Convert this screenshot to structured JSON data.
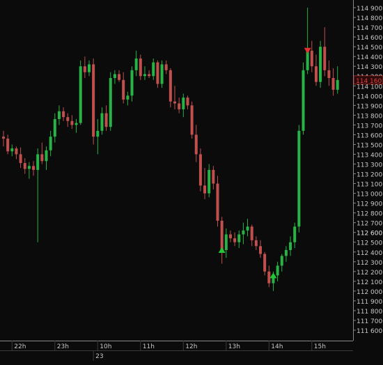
{
  "colors": {
    "background": "#0b0b0b",
    "up_candle": "#27b345",
    "down_candle": "#c0504d",
    "axis_text": "#c8c8c8",
    "axis_line": "#8a8a8a",
    "last_price_box": "#2a0a0a",
    "last_price_text": "#e04040",
    "buy_marker": "#22c832",
    "sell_marker": "#e83030"
  },
  "chart_data": {
    "type": "candlestick",
    "y_unit": "price",
    "ylim": [
      111550,
      114950
    ],
    "y_ticks": [
      "111 600",
      "111 700",
      "111 800",
      "111 900",
      "112 000",
      "112 100",
      "112 200",
      "112 300",
      "112 400",
      "112 500",
      "112 600",
      "112 700",
      "112 800",
      "112 900",
      "113 000",
      "113 100",
      "113 200",
      "113 300",
      "113 400",
      "113 500",
      "113 600",
      "113 700",
      "113 800",
      "113 900",
      "114 000",
      "114 100",
      "114 200",
      "114 300",
      "114 400",
      "114 500",
      "114 600",
      "114 700",
      "114 800",
      "114 900"
    ],
    "y_tick_values": [
      111600,
      111700,
      111800,
      111900,
      112000,
      112100,
      112200,
      112300,
      112400,
      112500,
      112600,
      112700,
      112800,
      112900,
      113000,
      113100,
      113200,
      113300,
      113400,
      113500,
      113600,
      113700,
      113800,
      113900,
      114000,
      114100,
      114200,
      114300,
      114400,
      114500,
      114600,
      114700,
      114800,
      114900
    ],
    "last_price": {
      "label": "114 160",
      "value": 114160
    },
    "right_edge_labels": [
      {
        "label": "112 600",
        "value": 112600
      }
    ],
    "x_time_labels": [
      {
        "label": "22h",
        "index": 2
      },
      {
        "label": "23h",
        "index": 12
      },
      {
        "label": "10h",
        "index": 22
      },
      {
        "label": "11h",
        "index": 32
      },
      {
        "label": "12h",
        "index": 42
      },
      {
        "label": "13h",
        "index": 52
      },
      {
        "label": "14h",
        "index": 62
      },
      {
        "label": "15h",
        "index": 72
      }
    ],
    "x_date_labels": [
      {
        "label": "23",
        "index": 21
      }
    ],
    "candles": [
      {
        "o": 113580,
        "h": 113640,
        "l": 113480,
        "c": 113560
      },
      {
        "o": 113560,
        "h": 113600,
        "l": 113400,
        "c": 113430
      },
      {
        "o": 113430,
        "h": 113500,
        "l": 113380,
        "c": 113460
      },
      {
        "o": 113460,
        "h": 113480,
        "l": 113350,
        "c": 113400
      },
      {
        "o": 113400,
        "h": 113470,
        "l": 113260,
        "c": 113310
      },
      {
        "o": 113310,
        "h": 113360,
        "l": 113200,
        "c": 113250
      },
      {
        "o": 113250,
        "h": 113320,
        "l": 113150,
        "c": 113280
      },
      {
        "o": 113280,
        "h": 113330,
        "l": 113180,
        "c": 113240
      },
      {
        "o": 113240,
        "h": 113460,
        "l": 112500,
        "c": 113400
      },
      {
        "o": 113400,
        "h": 113520,
        "l": 113300,
        "c": 113330
      },
      {
        "o": 113330,
        "h": 113480,
        "l": 113240,
        "c": 113440
      },
      {
        "o": 113440,
        "h": 113640,
        "l": 113380,
        "c": 113580
      },
      {
        "o": 113580,
        "h": 113820,
        "l": 113520,
        "c": 113760
      },
      {
        "o": 113760,
        "h": 113900,
        "l": 113700,
        "c": 113840
      },
      {
        "o": 113840,
        "h": 113880,
        "l": 113740,
        "c": 113780
      },
      {
        "o": 113780,
        "h": 113820,
        "l": 113680,
        "c": 113740
      },
      {
        "o": 113740,
        "h": 113800,
        "l": 113660,
        "c": 113700
      },
      {
        "o": 113700,
        "h": 113760,
        "l": 113620,
        "c": 113720
      },
      {
        "o": 113720,
        "h": 114360,
        "l": 113700,
        "c": 114300
      },
      {
        "o": 114300,
        "h": 114400,
        "l": 114180,
        "c": 114240
      },
      {
        "o": 114240,
        "h": 114360,
        "l": 114200,
        "c": 114320
      },
      {
        "o": 114320,
        "h": 114380,
        "l": 113500,
        "c": 113580
      },
      {
        "o": 113580,
        "h": 113760,
        "l": 113400,
        "c": 113640
      },
      {
        "o": 113640,
        "h": 113880,
        "l": 113600,
        "c": 113820
      },
      {
        "o": 113820,
        "h": 113900,
        "l": 113640,
        "c": 113680
      },
      {
        "o": 113680,
        "h": 114240,
        "l": 113640,
        "c": 114180
      },
      {
        "o": 114180,
        "h": 114260,
        "l": 114120,
        "c": 114220
      },
      {
        "o": 114220,
        "h": 114260,
        "l": 114140,
        "c": 114160
      },
      {
        "o": 114160,
        "h": 114240,
        "l": 113920,
        "c": 113960
      },
      {
        "o": 113960,
        "h": 114040,
        "l": 113900,
        "c": 114000
      },
      {
        "o": 114000,
        "h": 114300,
        "l": 113940,
        "c": 114260
      },
      {
        "o": 114260,
        "h": 114460,
        "l": 114200,
        "c": 114380
      },
      {
        "o": 114380,
        "h": 114420,
        "l": 114160,
        "c": 114200
      },
      {
        "o": 114200,
        "h": 114300,
        "l": 114160,
        "c": 114220
      },
      {
        "o": 114220,
        "h": 114260,
        "l": 114180,
        "c": 114200
      },
      {
        "o": 114200,
        "h": 114380,
        "l": 114160,
        "c": 114340
      },
      {
        "o": 114340,
        "h": 114360,
        "l": 114080,
        "c": 114120
      },
      {
        "o": 114120,
        "h": 114360,
        "l": 114080,
        "c": 114320
      },
      {
        "o": 114320,
        "h": 114360,
        "l": 114220,
        "c": 114260
      },
      {
        "o": 114260,
        "h": 114280,
        "l": 113880,
        "c": 113940
      },
      {
        "o": 113940,
        "h": 114100,
        "l": 113860,
        "c": 113920
      },
      {
        "o": 113920,
        "h": 113980,
        "l": 113820,
        "c": 113860
      },
      {
        "o": 113860,
        "h": 114020,
        "l": 113780,
        "c": 113980
      },
      {
        "o": 113980,
        "h": 114000,
        "l": 113860,
        "c": 113900
      },
      {
        "o": 113900,
        "h": 113940,
        "l": 113560,
        "c": 113600
      },
      {
        "o": 113600,
        "h": 113700,
        "l": 113320,
        "c": 113400
      },
      {
        "o": 113400,
        "h": 113460,
        "l": 113020,
        "c": 113080
      },
      {
        "o": 113080,
        "h": 113260,
        "l": 112940,
        "c": 113000
      },
      {
        "o": 113000,
        "h": 113300,
        "l": 112960,
        "c": 113240
      },
      {
        "o": 113240,
        "h": 113280,
        "l": 113040,
        "c": 113100
      },
      {
        "o": 113100,
        "h": 113180,
        "l": 112660,
        "c": 112720
      },
      {
        "o": 112720,
        "h": 112760,
        "l": 112280,
        "c": 112420
      },
      {
        "o": 112420,
        "h": 112640,
        "l": 112340,
        "c": 112580
      },
      {
        "o": 112580,
        "h": 112620,
        "l": 112500,
        "c": 112540
      },
      {
        "o": 112540,
        "h": 112600,
        "l": 112460,
        "c": 112500
      },
      {
        "o": 112500,
        "h": 112620,
        "l": 112440,
        "c": 112580
      },
      {
        "o": 112580,
        "h": 112700,
        "l": 112480,
        "c": 112620
      },
      {
        "o": 112620,
        "h": 112740,
        "l": 112560,
        "c": 112660
      },
      {
        "o": 112660,
        "h": 112680,
        "l": 112460,
        "c": 112520
      },
      {
        "o": 112520,
        "h": 112560,
        "l": 112420,
        "c": 112460
      },
      {
        "o": 112460,
        "h": 112520,
        "l": 112340,
        "c": 112380
      },
      {
        "o": 112380,
        "h": 112400,
        "l": 112160,
        "c": 112200
      },
      {
        "o": 112200,
        "h": 112260,
        "l": 112040,
        "c": 112080
      },
      {
        "o": 112080,
        "h": 112200,
        "l": 112000,
        "c": 112160
      },
      {
        "o": 112160,
        "h": 112300,
        "l": 112100,
        "c": 112260
      },
      {
        "o": 112260,
        "h": 112380,
        "l": 112200,
        "c": 112360
      },
      {
        "o": 112360,
        "h": 112460,
        "l": 112300,
        "c": 112420
      },
      {
        "o": 112420,
        "h": 112560,
        "l": 112360,
        "c": 112500
      },
      {
        "o": 112500,
        "h": 112700,
        "l": 112440,
        "c": 112660
      },
      {
        "o": 112660,
        "h": 113700,
        "l": 112600,
        "c": 113640
      },
      {
        "o": 113640,
        "h": 114340,
        "l": 113600,
        "c": 114260
      },
      {
        "o": 114260,
        "h": 114900,
        "l": 114220,
        "c": 114460
      },
      {
        "o": 114460,
        "h": 114560,
        "l": 114240,
        "c": 114300
      },
      {
        "o": 114300,
        "h": 114420,
        "l": 114100,
        "c": 114140
      },
      {
        "o": 114140,
        "h": 114560,
        "l": 114080,
        "c": 114500
      },
      {
        "o": 114500,
        "h": 114700,
        "l": 114200,
        "c": 114260
      },
      {
        "o": 114260,
        "h": 114360,
        "l": 114100,
        "c": 114180
      },
      {
        "o": 114180,
        "h": 114280,
        "l": 114000,
        "c": 114060
      },
      {
        "o": 114060,
        "h": 114300,
        "l": 114020,
        "c": 114160
      }
    ],
    "markers": [
      {
        "type": "buy",
        "index": 51,
        "price": 112420
      },
      {
        "type": "buy",
        "index": 63,
        "price": 112160
      },
      {
        "type": "sell",
        "index": 71,
        "price": 114460
      }
    ]
  }
}
